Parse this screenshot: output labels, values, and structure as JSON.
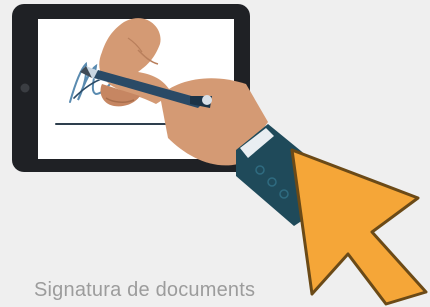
{
  "card": {
    "caption": "Signatura de documents",
    "icon": "tablet-signature-icon",
    "cursor_icon": "pointer-arrow-icon"
  },
  "colors": {
    "background": "#efefef",
    "tablet": "#1f2125",
    "screen": "#ffffff",
    "skin": "#d49a74",
    "sleeve": "#1f4a5a",
    "pen": "#2a4a66",
    "cursor": "#f5a638",
    "cursor_outline": "#6b4a17"
  }
}
